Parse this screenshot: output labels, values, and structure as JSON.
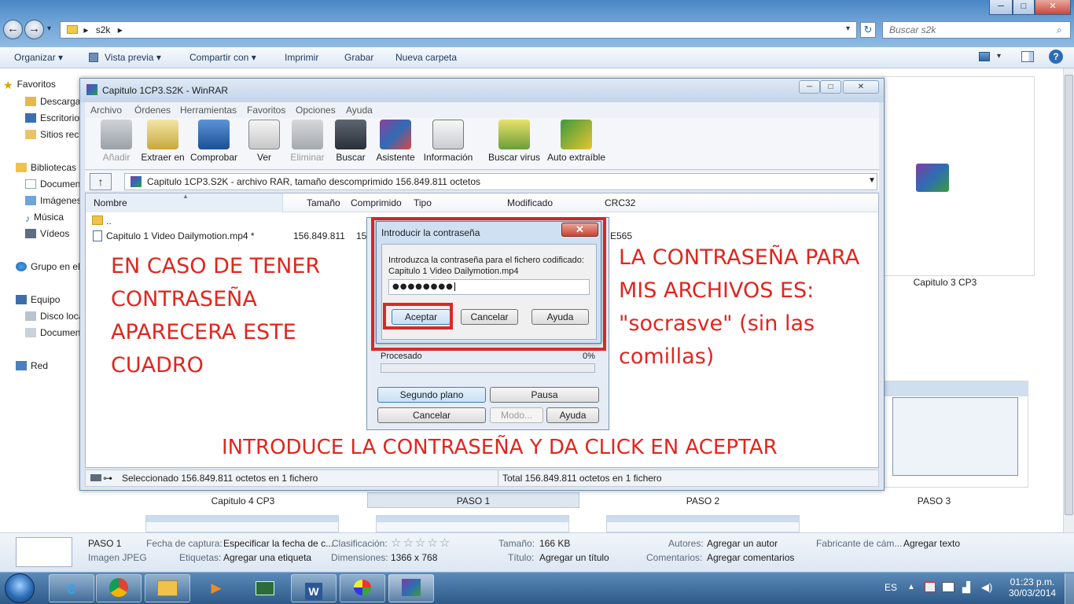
{
  "window_controls": {
    "minimize": "─",
    "maximize": "□",
    "close": "✕"
  },
  "address": {
    "crumb": "s2k",
    "refresh": "↻"
  },
  "search": {
    "placeholder": "Buscar s2k"
  },
  "commandbar": {
    "organize": "Organizar ▾",
    "preview": "Vista previa ▾",
    "share": "Compartir con ▾",
    "print": "Imprimir",
    "burn": "Grabar",
    "new_folder": "Nueva carpeta"
  },
  "navpane": {
    "favorites": "Favoritos",
    "downloads": "Descargas",
    "desktop": "Escritorio",
    "recent": "Sitios recientes",
    "libraries": "Bibliotecas",
    "documents": "Documentos",
    "images": "Imágenes",
    "music": "Música",
    "videos": "Vídeos",
    "homegroup": "Grupo en el hogar",
    "computer": "Equipo",
    "local_disk": "Disco local",
    "documents2": "Documentos",
    "network": "Red"
  },
  "thumbnails": {
    "cap3": "Capitulo 3  CP3",
    "cap4": "Capitulo 4   CP3",
    "paso1": "PASO 1",
    "paso2": "PASO 2",
    "paso3": "PASO 3"
  },
  "winrar": {
    "title": "Capitulo 1CP3.S2K - WinRAR",
    "menu": [
      "Archivo",
      "Órdenes",
      "Herramientas",
      "Favoritos",
      "Opciones",
      "Ayuda"
    ],
    "tools": [
      "Añadir",
      "Extraer en",
      "Comprobar",
      "Ver",
      "Eliminar",
      "Buscar",
      "Asistente",
      "Información",
      "Buscar virus",
      "Auto extraíble"
    ],
    "path": "Capitulo 1CP3.S2K - archivo RAR, tamaño descomprimido 156.849.811 octetos",
    "columns": {
      "name": "Nombre",
      "size": "Tamaño",
      "packed": "Comprimido",
      "type": "Tipo",
      "modified": "Modificado",
      "crc": "CRC32"
    },
    "rows": {
      "parent": "..",
      "file_name": "Capitulo 1   Video Dailymotion.mp4 *",
      "file_size": "156.849.811",
      "file_packed": "15",
      "file_crc": "E565"
    },
    "status_left": "Seleccionado 156.849.811 octetos en 1 fichero",
    "status_right": "Total 156.849.811 octetos en 1 fichero"
  },
  "progress": {
    "label": "Procesado",
    "percent": "0%",
    "background": "Segundo plano",
    "pause": "Pausa",
    "cancel": "Cancelar",
    "mode": "Modo...",
    "help": "Ayuda"
  },
  "password_dialog": {
    "title": "Introducir la contraseña",
    "prompt": "Introduzca la contraseña para el fichero codificado:",
    "filename": "Capitulo 1   Video Dailymotion.mp4",
    "masked_value": "●●●●●●●●",
    "ok": "Aceptar",
    "cancel": "Cancelar",
    "help": "Ayuda"
  },
  "annotations": {
    "left": [
      "EN CASO DE TENER",
      "CONTRASEÑA",
      "APARECERA ESTE",
      "CUADRO"
    ],
    "right": [
      "LA CONTRASEÑA PARA",
      "MIS ARCHIVOS ES:",
      "\"socrasve\" (sin las",
      "comillas)"
    ],
    "bottom": "INTRODUCE LA CONTRASEÑA Y DA CLICK EN ACEPTAR"
  },
  "details": {
    "name": "PASO 1",
    "filetype": "Imagen JPEG",
    "capture_label": "Fecha de captura:",
    "capture_value": "Especificar la fecha de c...",
    "rating_label": "Clasificación:",
    "rating_stars": "☆☆☆☆☆",
    "size_label": "Tamaño:",
    "size_value": "166 KB",
    "authors_label": "Autores:",
    "authors_value": "Agregar un autor",
    "maker_label": "Fabricante de cám...",
    "maker_value": "Agregar texto",
    "tags_label": "Etiquetas:",
    "tags_value": "Agregar una etiqueta",
    "dims_label": "Dimensiones:",
    "dims_value": "1366 x 768",
    "title_label": "Título:",
    "title_value": "Agregar un título",
    "comments_label": "Comentarios:",
    "comments_value": "Agregar comentarios"
  },
  "taskbar": {
    "lang": "ES",
    "time": "01:23 p.m.",
    "date": "30/03/2014"
  },
  "colors": {
    "annotation": "#e0261e",
    "highlight_box": "#d92a2a",
    "taskbar": "#2d5a89"
  }
}
